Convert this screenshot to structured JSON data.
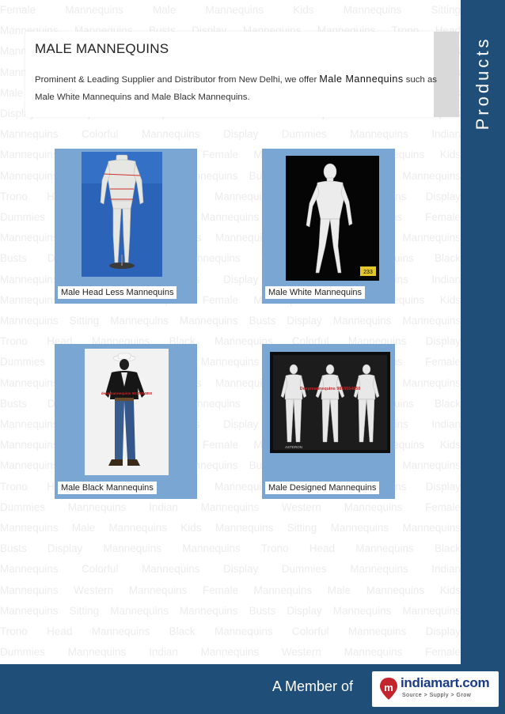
{
  "header": {
    "title": "MALE MANNEQUINS",
    "desc_before": "Prominent & Leading Supplier and Distributor from New Delhi, we offer ",
    "desc_bold": "Male Mannequins",
    "desc_after": " such as Male White Mannequins and Male Black Mannequins."
  },
  "sidebar": {
    "label": "Products"
  },
  "products": [
    {
      "caption": "Male Head Less Mannequins"
    },
    {
      "caption": "Male White Mannequins",
      "badge": "233"
    },
    {
      "caption": "Male Black Mannequins",
      "watermark": "deepmannequins 9810554850"
    },
    {
      "caption": "Male Designed Mannequins",
      "watermark": "Deepmannequins 9810554850",
      "tag": "ASTERON"
    }
  ],
  "footer": {
    "member_text": "A Member of",
    "logo_name": "indiamart.com",
    "logo_tagline": "Source  >  Supply  >  Grow"
  },
  "colors": {
    "bar": "#1f4e79",
    "card": "#7aa6d4"
  },
  "watermark_lines": [
    "Female Mannequins Male Mannequins Kids Mannequins Sitting",
    "Mannequins Mannequins Busts Display Mannequins Mannequins Trono Head",
    "Mannequins Black Mannequins Colorful Mannequins Display Dummies",
    "Mannequins Indian Mannequins Western Mannequins Female Mannequins",
    "Male Mannequins Kids Mannequins Sitting Mannequins Mannequins Busts",
    "Display Mannequins Mannequins Trono Head Mannequins Black Mannequins",
    "Mannequins Colorful Mannequins Display Dummies Mannequins Indian",
    "Mannequins Western Mannequins Female Mannequins Male Mannequins Kids",
    "Mannequins Sitting Mannequins Mannequins Busts Display Mannequins Mannequins",
    "Trono Head Mannequins Black Mannequins Colorful Mannequins Display",
    "Dummies Mannequins Indian Mannequins Western Mannequins Female",
    "Mannequins Male Mannequins Kids Mannequins Sitting Mannequins Mannequins",
    "Busts Display Mannequins Mannequins Trono Head Mannequins Black",
    "Mannequins Colorful Mannequins Display Dummies Mannequins Indian",
    "Mannequins Western Mannequins Female Mannequins Male Mannequins Kids",
    "Mannequins Sitting Mannequins Mannequins Busts Display Mannequins Mannequins",
    "Trono Head Mannequins Black Mannequins Colorful Mannequins Display",
    "Dummies Mannequins Indian Mannequins Western Mannequins Female",
    "Mannequins Male Mannequins Kids Mannequins Sitting Mannequins Mannequins",
    "Busts Display Mannequins Mannequins Trono Head Mannequins Black",
    "Mannequins Colorful Mannequins Display Dummies Mannequins Indian",
    "Mannequins Western Mannequins Female Mannequins Male Mannequins Kids",
    "Mannequins Sitting Mannequins Mannequins Busts Display Mannequins Mannequins",
    "Trono Head Mannequins Black Mannequins Colorful Mannequins Display",
    "Dummies Mannequins Indian Mannequins Western Mannequins Female",
    "Mannequins Male Mannequins Kids Mannequins Sitting Mannequins Mannequins",
    "Busts Display Mannequins Mannequins Trono Head Mannequins Black",
    "Mannequins Colorful Mannequins Display Dummies Mannequins Indian",
    "Mannequins Western Mannequins Female Mannequins Male Mannequins Kids",
    "Mannequins Sitting Mannequins Mannequins Busts Display Mannequins Mannequins",
    "Trono Head Mannequins Black Mannequins Colorful Mannequins Display",
    "Dummies Mannequins Indian Mannequins Western Mannequins Female",
    "Mannequins Male Mannequins Kids Mannequins Sitting Mannequins Mannequins"
  ]
}
